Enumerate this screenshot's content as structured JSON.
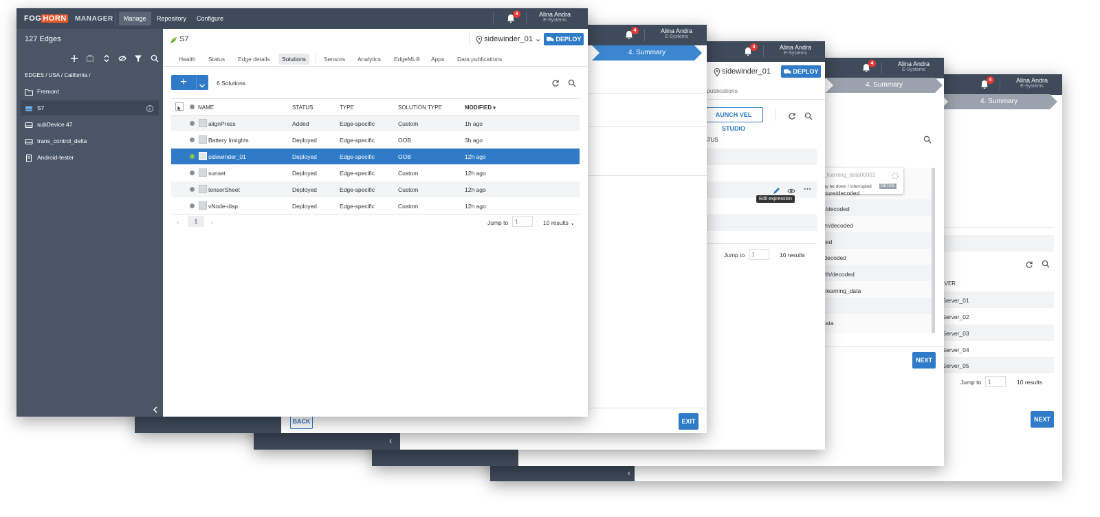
{
  "app": {
    "brand_a": "FOG",
    "brand_b": "HORN",
    "name": "MANAGER",
    "nav": [
      "Manage",
      "Repository",
      "Configure"
    ],
    "notifications": "4",
    "user_name": "Alina Andra",
    "user_company": "E-Systems"
  },
  "sidebar": {
    "count": "127 Edges",
    "breadcrumb": "EDGES / USA / California /",
    "items": [
      {
        "label": "Fremont",
        "icon": "folder-icon"
      },
      {
        "label": "S7",
        "icon": "device-icon"
      },
      {
        "label": "subDevice 47",
        "icon": "device-icon"
      },
      {
        "label": "trans_control_delta",
        "icon": "device-icon"
      },
      {
        "label": "Android-tester",
        "icon": "phone-icon"
      }
    ]
  },
  "edge": {
    "title": "S7",
    "location": "sidewinder_01",
    "deploy": "DEPLOY"
  },
  "tabs": [
    "Health",
    "Status",
    "Edge details",
    "Solutions",
    "Sensors",
    "Analytics",
    "EdgeML®",
    "Apps",
    "Data publications"
  ],
  "solutions": {
    "count_label": "6 Solutions",
    "columns": [
      "NAME",
      "STATUS",
      "TYPE",
      "SOLUTION TYPE",
      "MODIFIED"
    ],
    "rows": [
      {
        "name": "alignPress",
        "status": "Added",
        "type": "Edge-specific",
        "solution_type": "Custom",
        "modified": "1h ago"
      },
      {
        "name": "Battery Insights",
        "status": "Deployed",
        "type": "Edge-specific",
        "solution_type": "OOB",
        "modified": "3h ago"
      },
      {
        "name": "sidewinder_01",
        "status": "Deployed",
        "type": "Edge-specific",
        "solution_type": "OOB",
        "modified": "12h ago"
      },
      {
        "name": "sunset",
        "status": "Deployed",
        "type": "Edge-specific",
        "solution_type": "Custom",
        "modified": "12h ago"
      },
      {
        "name": "tensorSheet",
        "status": "Deployed",
        "type": "Edge-specific",
        "solution_type": "Custom",
        "modified": "12h ago"
      },
      {
        "name": "vNode-disp",
        "status": "Deployed",
        "type": "Edge-specific",
        "solution_type": "Custom",
        "modified": "12h ago"
      }
    ],
    "page": "1",
    "jump_label": "Jump to",
    "jump_placeholder": "1",
    "results": "10 results"
  },
  "wizard": {
    "summary": "4. Summary",
    "back": "BACK",
    "exit": "EXIT",
    "next": "NEXT",
    "launch": "AUNCH VEL STUDIO",
    "publications": "publications",
    "atus": "ATUS",
    "tooltip": "Edit expression",
    "popover_value": "_learning_data00001",
    "popover_warn": "ay be down / interrupted",
    "popover_detail": "DETAIL",
    "topics": [
      "ature/decoded",
      "n/decoded",
      "ter/decoded",
      "ded",
      "/decoded",
      "dth/decoded",
      "_learning_data",
      "data"
    ],
    "servers": [
      "RVER",
      "/Server_01",
      "/Server_02",
      "/Server_03",
      "/Server_04",
      "/Server_05"
    ]
  }
}
